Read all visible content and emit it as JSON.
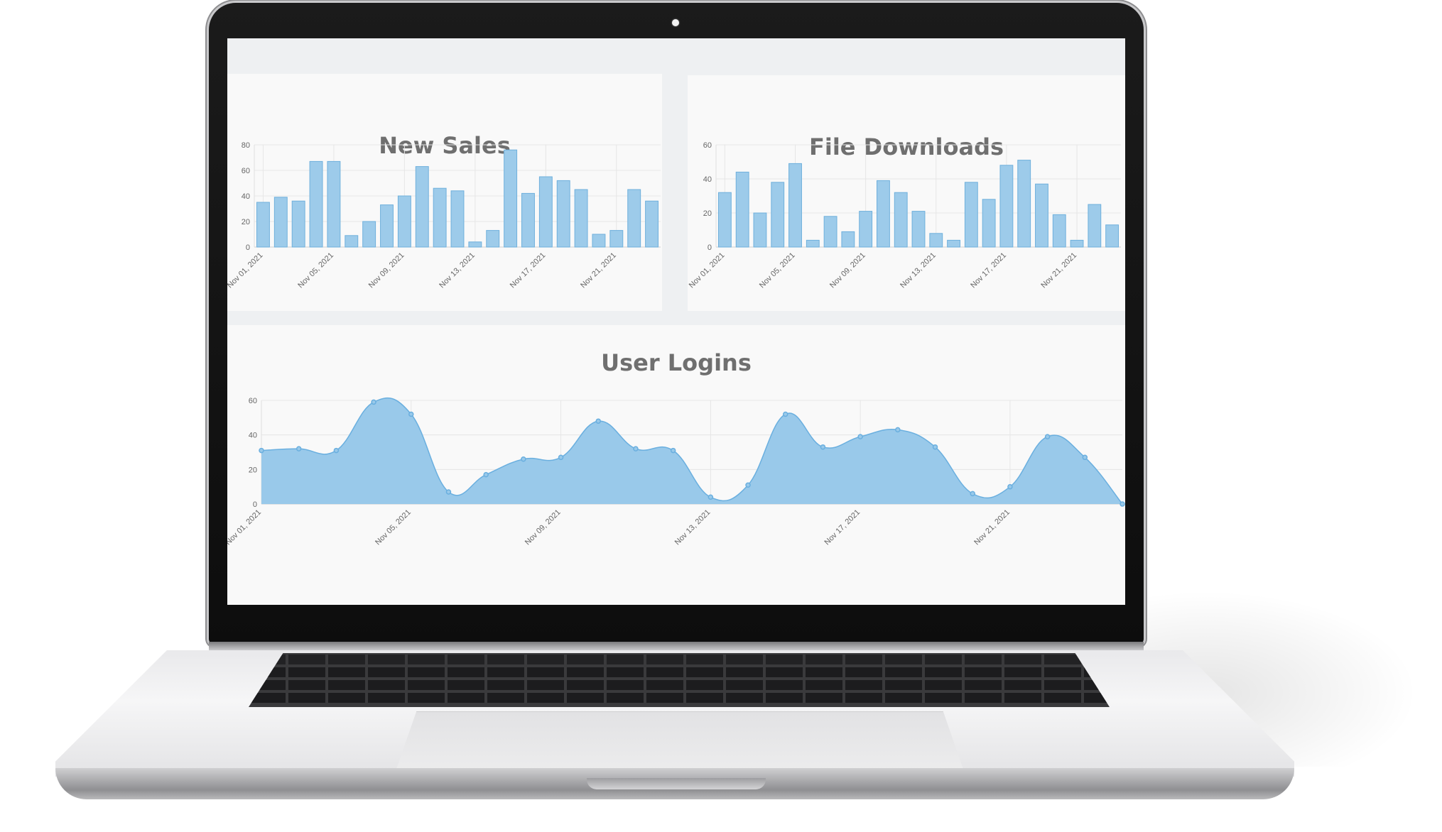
{
  "colors": {
    "bar_fill": "#9dcbea",
    "bar_stroke": "#6fb0dc",
    "area_fill": "#99c9ea",
    "area_stroke": "#6aafdf",
    "title": "#6f6f6f"
  },
  "chart_data": [
    {
      "id": "new-sales",
      "type": "bar",
      "title": "New Sales",
      "ylim": [
        0,
        80
      ],
      "yticks": [
        0,
        20,
        40,
        60,
        80
      ],
      "grid": true,
      "x_tick_labels": [
        {
          "label": "Nov 01, 2021",
          "index": 0
        },
        {
          "label": "Nov 05, 2021",
          "index": 4
        },
        {
          "label": "Nov 09, 2021",
          "index": 8
        },
        {
          "label": "Nov 13, 2021",
          "index": 12
        },
        {
          "label": "Nov 17, 2021",
          "index": 16
        },
        {
          "label": "Nov 21, 2021",
          "index": 20
        }
      ],
      "values": [
        35,
        39,
        36,
        67,
        67,
        9,
        20,
        33,
        40,
        63,
        46,
        44,
        4,
        13,
        76,
        42,
        55,
        52,
        45,
        10,
        13,
        45,
        36
      ]
    },
    {
      "id": "file-downloads",
      "type": "bar",
      "title": "File Downloads",
      "ylim": [
        0,
        60
      ],
      "yticks": [
        0,
        20,
        40,
        60
      ],
      "grid": true,
      "x_tick_labels": [
        {
          "label": "Nov 01, 2021",
          "index": 0
        },
        {
          "label": "Nov 05, 2021",
          "index": 4
        },
        {
          "label": "Nov 09, 2021",
          "index": 8
        },
        {
          "label": "Nov 13, 2021",
          "index": 12
        },
        {
          "label": "Nov 17, 2021",
          "index": 16
        },
        {
          "label": "Nov 21, 2021",
          "index": 20
        }
      ],
      "values": [
        32,
        44,
        20,
        38,
        49,
        4,
        18,
        9,
        21,
        39,
        32,
        21,
        8,
        4,
        38,
        28,
        48,
        51,
        37,
        19,
        4,
        25,
        13
      ]
    },
    {
      "id": "user-logins",
      "type": "area",
      "title": "User Logins",
      "ylim": [
        0,
        60
      ],
      "yticks": [
        0,
        20,
        40,
        60
      ],
      "grid": true,
      "x_tick_labels": [
        {
          "label": "Nov 01, 2021",
          "index": 0
        },
        {
          "label": "Nov 05, 2021",
          "index": 4
        },
        {
          "label": "Nov 09, 2021",
          "index": 8
        },
        {
          "label": "Nov 13, 2021",
          "index": 12
        },
        {
          "label": "Nov 17, 2021",
          "index": 16
        },
        {
          "label": "Nov 21, 2021",
          "index": 20
        }
      ],
      "values": [
        31,
        32,
        31,
        59,
        52,
        7,
        17,
        26,
        27,
        48,
        32,
        31,
        4,
        11,
        52,
        33,
        39,
        43,
        33,
        6,
        10,
        39,
        27,
        0
      ]
    }
  ]
}
